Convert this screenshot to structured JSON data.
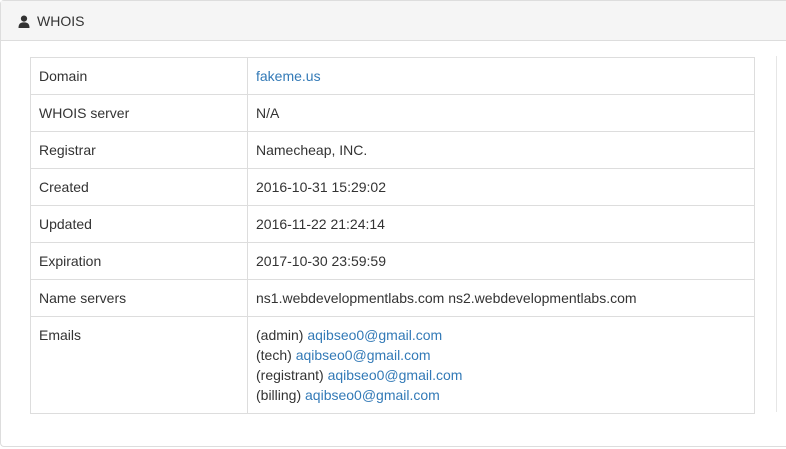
{
  "panel": {
    "title": "WHOIS",
    "icon": "user-icon"
  },
  "rows": [
    {
      "key": "Domain",
      "value": "fakeme.us",
      "link": true
    },
    {
      "key": "WHOIS server",
      "value": "N/A",
      "link": false
    },
    {
      "key": "Registrar",
      "value": "Namecheap, INC.",
      "link": false
    },
    {
      "key": "Created",
      "value": "2016-10-31 15:29:02",
      "link": false
    },
    {
      "key": "Updated",
      "value": "2016-11-22 21:24:14",
      "link": false
    },
    {
      "key": "Expiration",
      "value": "2017-10-30 23:59:59",
      "link": false
    },
    {
      "key": "Name servers",
      "value": "ns1.webdevelopmentlabs.com ns2.webdevelopmentlabs.com",
      "link": false
    }
  ],
  "emails": {
    "key": "Emails",
    "items": [
      {
        "role": "(admin)",
        "address": "aqibseo0@gmail.com"
      },
      {
        "role": "(tech)",
        "address": "aqibseo0@gmail.com"
      },
      {
        "role": "(registrant)",
        "address": "aqibseo0@gmail.com"
      },
      {
        "role": "(billing)",
        "address": "aqibseo0@gmail.com"
      }
    ]
  },
  "colors": {
    "link": "#337ab7",
    "text": "#333333",
    "border": "#dddddd",
    "heading_bg": "#f5f5f5"
  }
}
